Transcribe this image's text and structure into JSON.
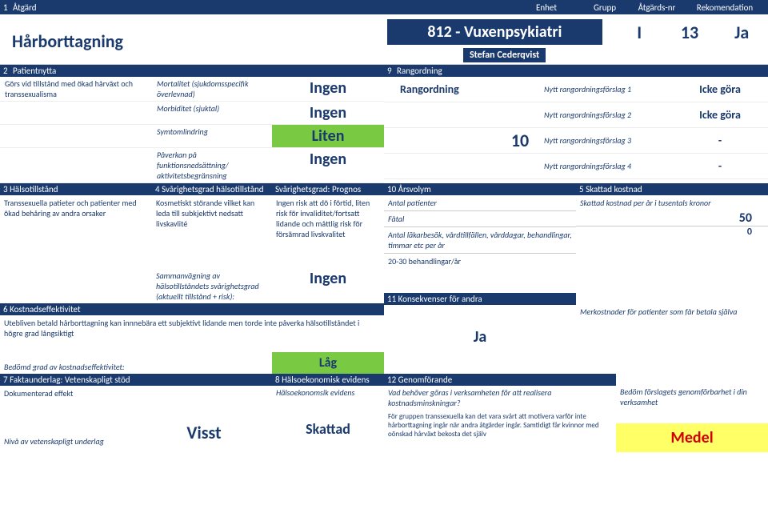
{
  "header": {
    "num": "1",
    "action": "Åtgärd",
    "enhet": "Enhet",
    "grupp": "Grupp",
    "nr": "Åtgärds-nr",
    "rek": "Rekomendation"
  },
  "top": {
    "title": "Hårborttagning",
    "enhet_title": "812 - Vuxenpsykiatri",
    "grupp": "I",
    "nr": "13",
    "rek": "Ja",
    "author": "Stefan Cederqvist"
  },
  "patientnytta": {
    "num": "2",
    "head": "Patientnytta",
    "desc": "Görs vid tillstånd med ökad hårväxt och transsexualisma",
    "rows": [
      {
        "label": "Mortalitet (sjukdomsspecifik överlevnad)",
        "val": "Ingen",
        "cls": ""
      },
      {
        "label": "Morbiditet (sjuktal)",
        "val": "Ingen",
        "cls": ""
      },
      {
        "label": "Symtomlindring",
        "val": "Liten",
        "cls": "green"
      },
      {
        "label": "Påverkan på funktionsnedsättning/ aktivitetsbegränsning",
        "val": "Ingen",
        "cls": ""
      }
    ]
  },
  "rangordning": {
    "num": "9",
    "head": "Rangordning",
    "title": "Rangordning",
    "rows": [
      {
        "label": "Nytt rangordningsförslag 1",
        "val": "Icke göra"
      },
      {
        "label": "Nytt rangordningsförslag 2",
        "val": "Icke göra"
      },
      {
        "label": "Nytt rangordningsförslag 3",
        "val": "-"
      },
      {
        "label": "Nytt rangordningsförslag 4",
        "val": "-"
      }
    ],
    "score": "10"
  },
  "s3": {
    "c1": {
      "num": "3",
      "head": "Hälsotillstånd",
      "body": "Transsexuella patieter och patienter med ökad behåring av andra orsaker"
    },
    "c2": {
      "num": "4",
      "head": "Svårighetsgrad hälsotillstånd",
      "body": "Kosmetiskt störande vilket kan leda till subkjektivt nedsatt livskavlité"
    },
    "c3": {
      "head": "Svårighetsgrad: Prognos",
      "body": "Ingen risk att dö i förtid, liten risk för invaliditet/fortsatt lidande och måttlig risk för försämrad livskvalitet"
    },
    "c4": {
      "num": "10",
      "head": "Årsvolym",
      "r1": "Antal patienter",
      "r2": "Fåtal",
      "r3": "Antal läkarbesök, vårdtillfällen, vårddagar, behandlingar, timmar etc per år",
      "r4": "20-30 behandlingar/år"
    },
    "c5": {
      "num": "5",
      "head": "Skattad kostnad",
      "r1": "Skattad kostnad per år i tusentals kronor",
      "v1": "50",
      "v2": "0"
    }
  },
  "s6": {
    "num": "6",
    "head": "Kostnadseffektivitet",
    "samman_label": "Sammanvägning av hälsotillståndets svårighetsgrad (aktuellt tillstånd + risk):",
    "samman_val": "Ingen",
    "body": "Utebliven betald hårborttagning kan innnebära ett subjektivt lidande men torde inte påverka hälsotillståndet i högre grad långsiktigt",
    "bedomd": "Bedömd grad av kostnadseffektivitet:",
    "lag": "Låg"
  },
  "s11": {
    "num": "11",
    "head": "Konsekvenser för andra",
    "ja": "Ja",
    "merc": "Merkostnader för patienter som får betala själva"
  },
  "s7": {
    "num": "7",
    "head": "Faktaunderlag: Vetenskapligt stöd",
    "sub": "Dokumenterad effekt",
    "niv": "Nivå av vetenskapligt underlag",
    "val": "Visst"
  },
  "s8": {
    "num": "8",
    "head": "Hälsoekonomisk evidens",
    "sub": "Hälsoekonomsik evidens",
    "val": "Skattad"
  },
  "s12": {
    "num": "12",
    "head": "Genomförande",
    "q": "Vad behöver göras i verksamheten för att realisera kostnadsminskningar?",
    "body": "För gruppen transsexuella kan det vara svårt att motivera varför inte hårborttagning ingår när andra åtgärder ingår. Samtidigt får kvinnor med oönskad hårväxt bekosta det själv",
    "bedom": "Bedöm förslagets genomförbarhet i din verksamhet",
    "val": "Medel"
  }
}
